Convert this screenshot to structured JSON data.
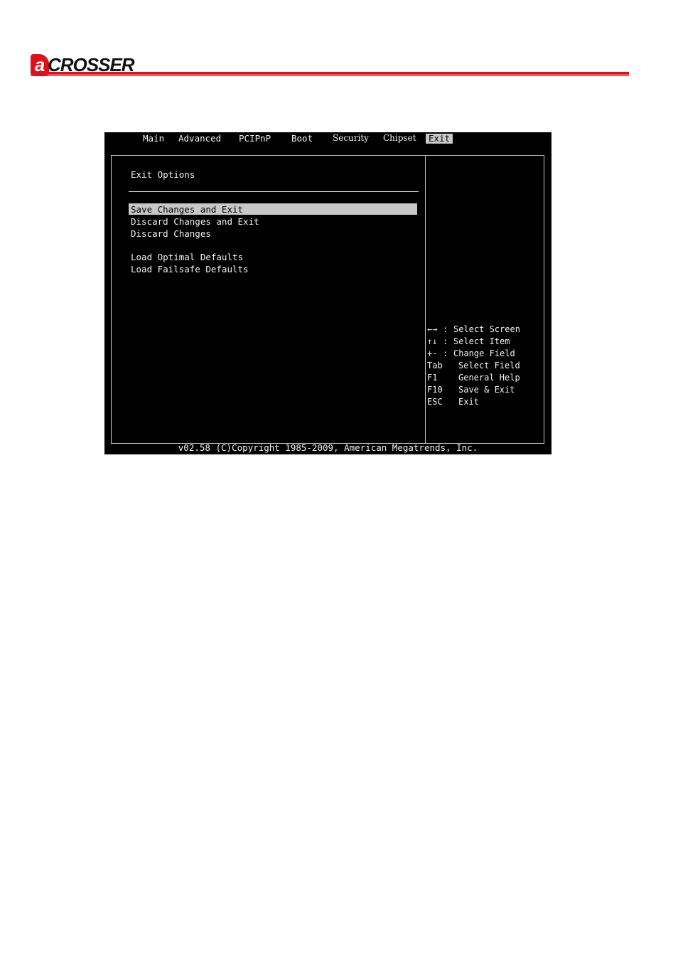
{
  "header": {
    "logo_initial": "a",
    "logo_text": "CROSSER",
    "brand_color": "#e0101a"
  },
  "bios": {
    "tabs": [
      "Main",
      "Advanced",
      "PCIPnP",
      "Boot",
      "Security",
      "Chipset",
      "Exit"
    ],
    "active_tab": "Exit",
    "section_title": "Exit Options",
    "menu_items": [
      "Save Changes and Exit",
      "Discard Changes and Exit",
      "Discard Changes",
      "Load Optimal Defaults",
      "Load Failsafe Defaults"
    ],
    "selected_item": "Save Changes and Exit",
    "help": [
      {
        "key": "←→",
        "sep": ":",
        "action": "Select Screen"
      },
      {
        "key": "↑↓",
        "sep": ":",
        "action": "Select Item"
      },
      {
        "key": "+-",
        "sep": ":",
        "action": "Change Field"
      },
      {
        "key": "Tab",
        "sep": "",
        "action": "Select Field"
      },
      {
        "key": "F1",
        "sep": "",
        "action": "General Help"
      },
      {
        "key": "F10",
        "sep": "",
        "action": "Save & Exit"
      },
      {
        "key": "ESC",
        "sep": "",
        "action": "Exit"
      }
    ],
    "footer": "v02.58 (C)Copyright 1985-2009, American Megatrends, Inc."
  }
}
